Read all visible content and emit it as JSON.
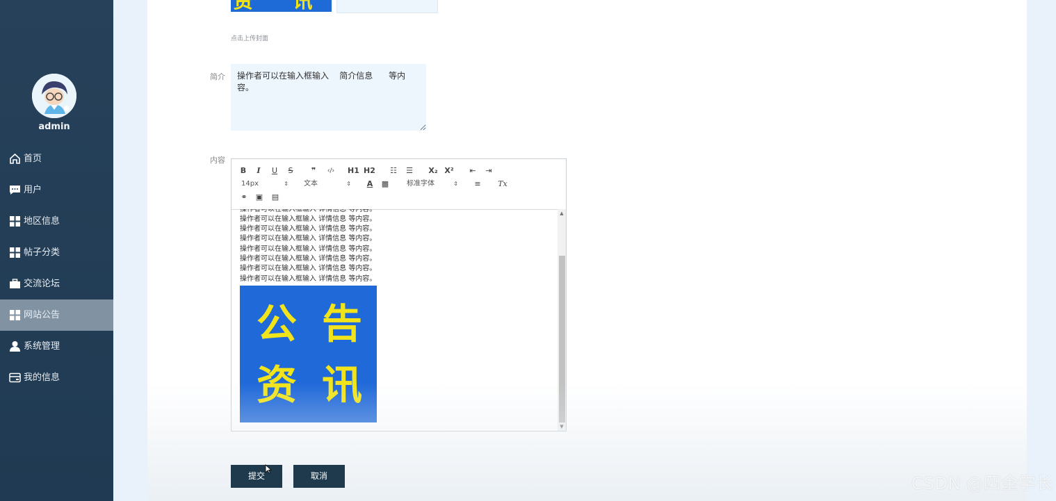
{
  "sidebar": {
    "username": "admin",
    "items": [
      {
        "label": "首页",
        "icon": "home-icon"
      },
      {
        "label": "用户",
        "icon": "chat-icon"
      },
      {
        "label": "地区信息",
        "icon": "grid-icon"
      },
      {
        "label": "帖子分类",
        "icon": "grid-icon"
      },
      {
        "label": "交流论坛",
        "icon": "briefcase-icon"
      },
      {
        "label": "网站公告",
        "icon": "grid-icon"
      },
      {
        "label": "系统管理",
        "icon": "user-icon"
      },
      {
        "label": "我的信息",
        "icon": "card-icon"
      }
    ]
  },
  "form": {
    "upload_hint": "点击上传封面",
    "summary_label": "简介",
    "summary_value": "操作者可以在输入框输入    简介信息      等内容。",
    "content_label": "内容",
    "cover_text": "资 讯",
    "submit_label": "提交",
    "cancel_label": "取消"
  },
  "editor": {
    "toolbar": {
      "bold": "B",
      "italic": "I",
      "underline": "U",
      "strike": "S",
      "quote": "❞",
      "code": "‹/›",
      "h1": "H1",
      "h2": "H2",
      "ordered_list": "☷",
      "bullet_list": "☰",
      "subscript": "X₂",
      "superscript": "X²",
      "outdent": "⇤",
      "indent": "⇥",
      "size": "14px",
      "block_type": "文本",
      "font": "标准字体",
      "clear_format": "Tx"
    },
    "lines": [
      "操作者可以在输入框输入  详情信息  等内容。",
      "操作者可以在输入框输入  详情信息  等内容。",
      "操作者可以在输入框输入  详情信息  等内容。",
      "操作者可以在输入框输入  详情信息  等内容。",
      "操作者可以在输入框输入  详情信息  等内容。",
      "操作者可以在输入框输入  详情信息  等内容。",
      "操作者可以在输入框输入  详情信息  等内容。",
      "操作者可以在输入框输入  详情信息  等内容。"
    ],
    "image_chars": [
      "公",
      "告",
      "资",
      "讯"
    ]
  },
  "watermark": "CSDN @四金学长",
  "colors": {
    "sidebar_bg": "#1f3a52",
    "active_item": "#8193a2",
    "button_bg": "#1f3a4d",
    "image_blue": "#2069d9",
    "image_yellow": "#f1e41b"
  }
}
